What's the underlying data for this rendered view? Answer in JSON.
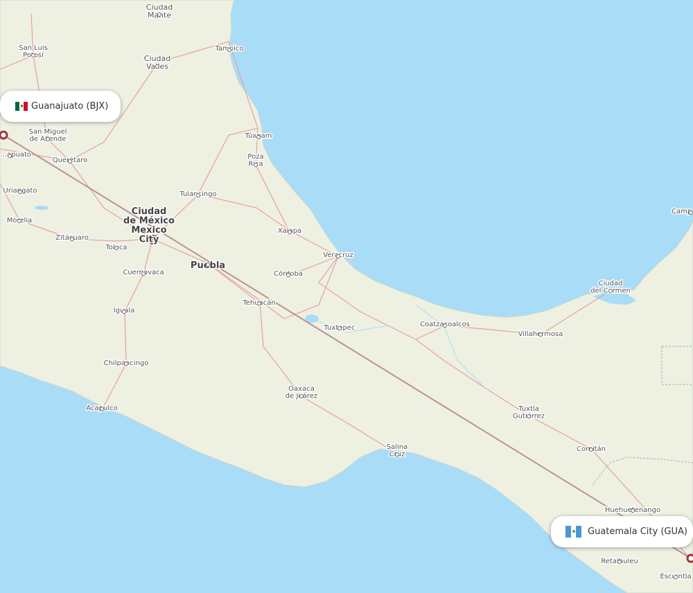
{
  "map": {
    "colors": {
      "water": "#a9dcf7",
      "land": "#eef0e2",
      "route": "#b58a86",
      "airport": "#a23238"
    },
    "cities": [
      {
        "id": "mante",
        "label": "Ciudad\nMante"
      },
      {
        "id": "tampico",
        "label": "Tampico"
      },
      {
        "id": "slp",
        "label": "San Luis\nPotosí"
      },
      {
        "id": "valles",
        "label": "Ciudad\nValles"
      },
      {
        "id": "tuxpam",
        "label": "Túxpam"
      },
      {
        "id": "sma",
        "label": "San Miguel\nde Allende"
      },
      {
        "id": "gto",
        "label": "…apuato"
      },
      {
        "id": "queretaro",
        "label": "Querétaro"
      },
      {
        "id": "pozarica",
        "label": "Poza\nRica"
      },
      {
        "id": "uriangato",
        "label": "Uriangato"
      },
      {
        "id": "tulancingo",
        "label": "Tulancingo"
      },
      {
        "id": "cdmx",
        "label": "Ciudad\nde México\nMexico\nCity"
      },
      {
        "id": "morelia",
        "label": "Morelia"
      },
      {
        "id": "xalapa",
        "label": "Xalapa"
      },
      {
        "id": "zitacuaro",
        "label": "Zitácuaro"
      },
      {
        "id": "toluca",
        "label": "Toluca"
      },
      {
        "id": "veracruz",
        "label": "Veracruz"
      },
      {
        "id": "puebla",
        "label": "Puebla"
      },
      {
        "id": "cuernavaca",
        "label": "Cuernavaca"
      },
      {
        "id": "cordoba",
        "label": "Córdoba"
      },
      {
        "id": "campeche",
        "label": "Camp…"
      },
      {
        "id": "carmen",
        "label": "Ciudad\ndel Carmen"
      },
      {
        "id": "tehuacan",
        "label": "Tehuacán"
      },
      {
        "id": "iguala",
        "label": "Iguala"
      },
      {
        "id": "coatza",
        "label": "Coatzacoalcos"
      },
      {
        "id": "tuxtepec",
        "label": "Tuxtepec"
      },
      {
        "id": "villahermosa",
        "label": "Villahermosa"
      },
      {
        "id": "chilpancingo",
        "label": "Chilpancingo"
      },
      {
        "id": "oaxaca",
        "label": "Oaxaca\nde Juárez"
      },
      {
        "id": "acapulco",
        "label": "Acapulco"
      },
      {
        "id": "tuxtla",
        "label": "Tuxtla\nGutiérrez"
      },
      {
        "id": "salinacruz",
        "label": "Salina\nCruz"
      },
      {
        "id": "comitan",
        "label": "Comitán"
      },
      {
        "id": "huehue",
        "label": "Huehuetenango"
      },
      {
        "id": "retalhuleu",
        "label": "Retalhuleu"
      },
      {
        "id": "escuintla",
        "label": "Escuintla"
      }
    ],
    "origin": {
      "name": "Guanajuato (BJX)",
      "country": "mx"
    },
    "destination": {
      "name": "Guatemala City (GUA)",
      "country": "gt"
    }
  }
}
